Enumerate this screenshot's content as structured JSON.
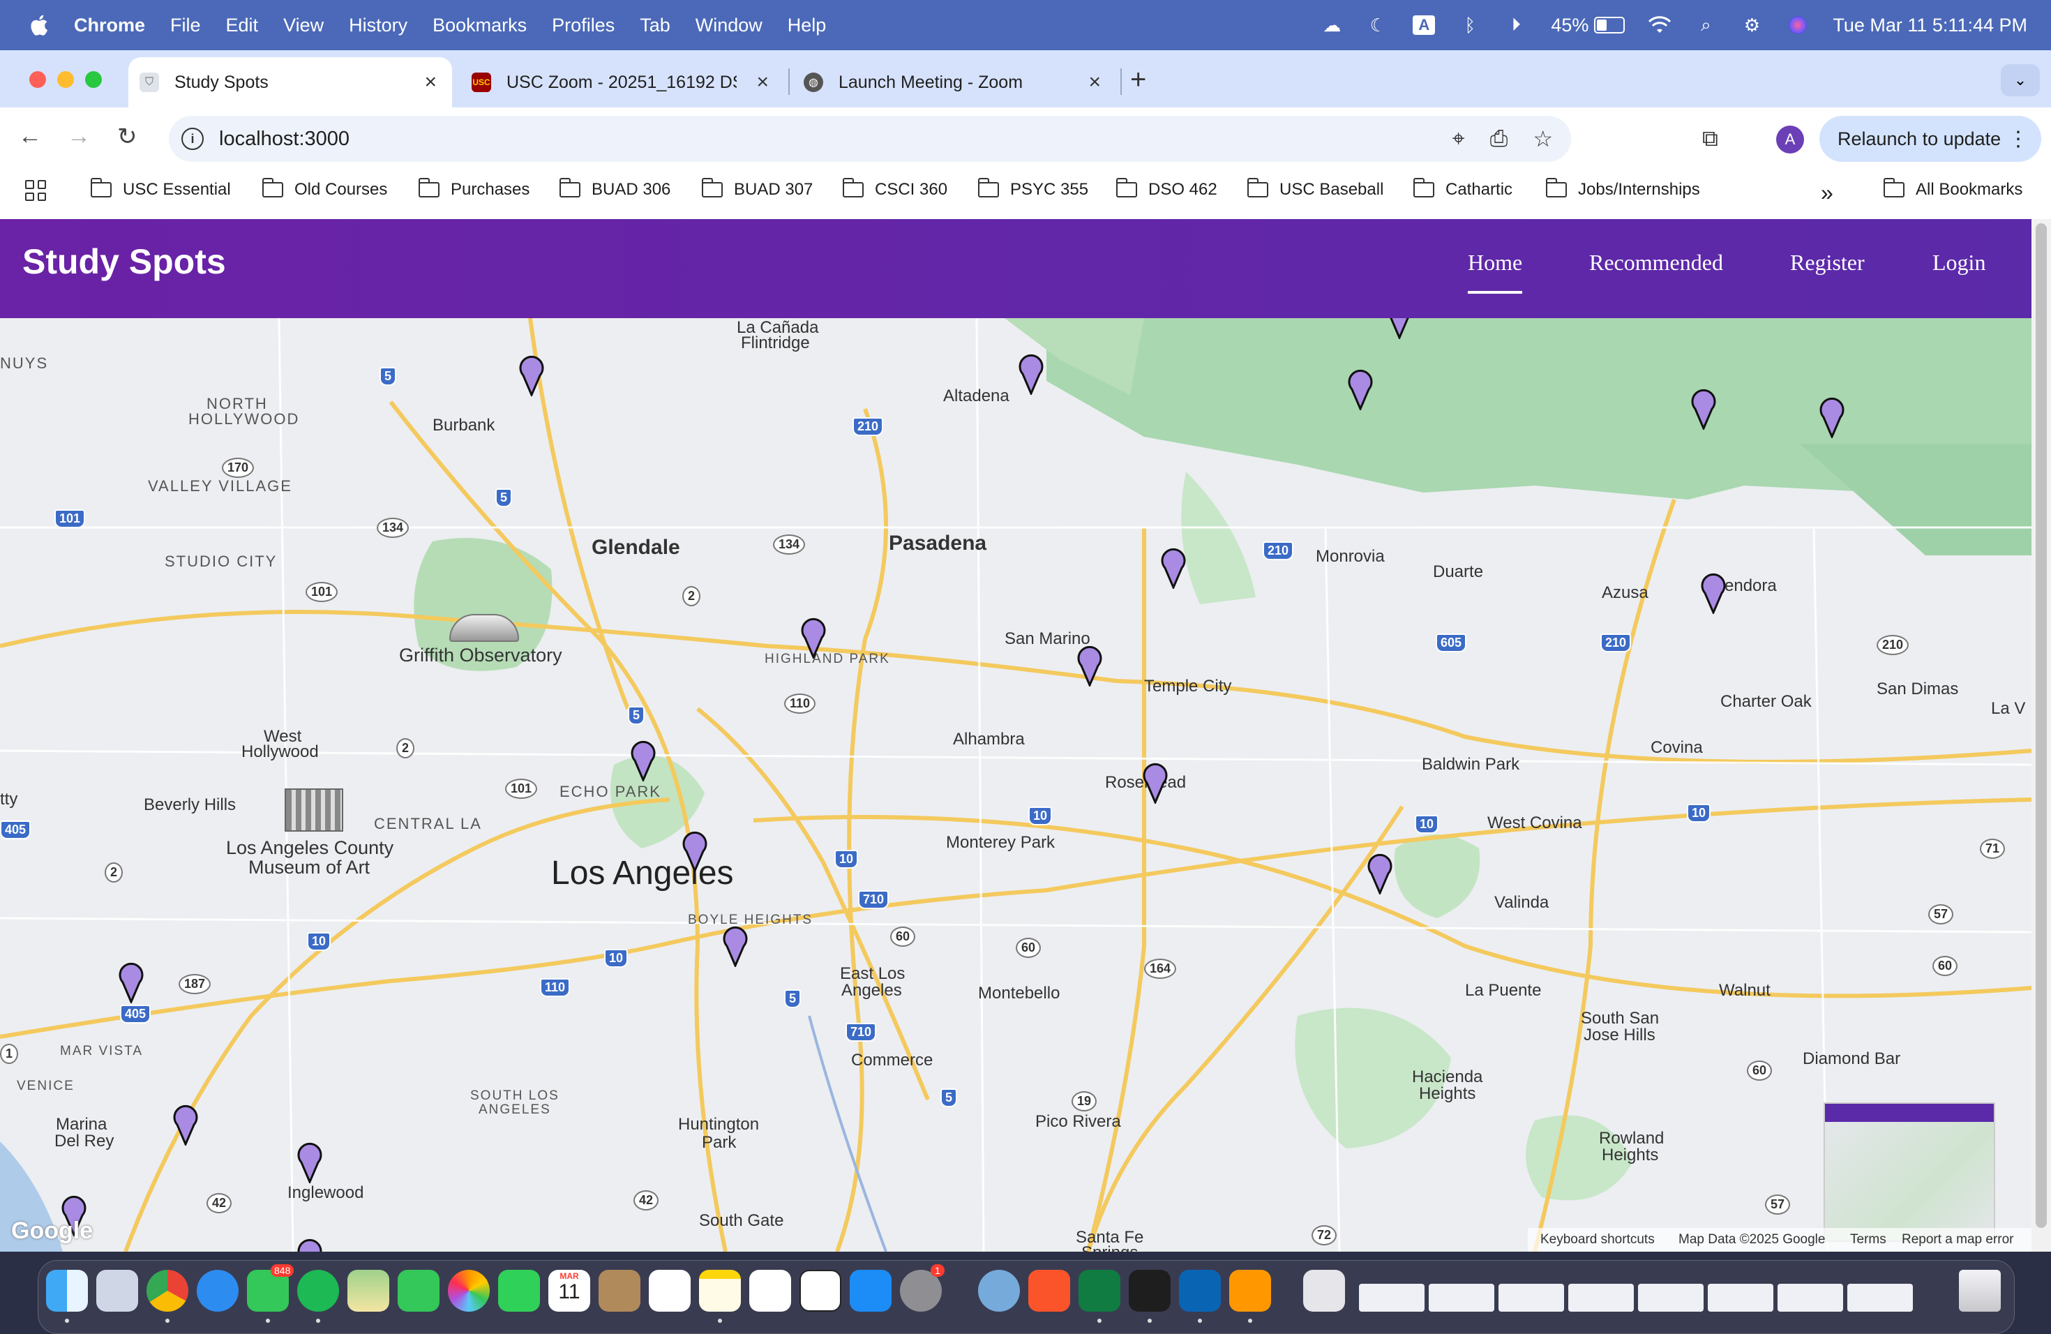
{
  "menubar": {
    "app": "Chrome",
    "items": [
      "File",
      "Edit",
      "View",
      "History",
      "Bookmarks",
      "Profiles",
      "Tab",
      "Window",
      "Help"
    ],
    "battery_percent": "45%",
    "battery_level": 0.45,
    "datetime": "Tue Mar 11  5:11:44 PM"
  },
  "tabs": [
    {
      "title": "Study Spots",
      "active": true
    },
    {
      "title": "USC Zoom - 20251_16192 DS",
      "active": false
    },
    {
      "title": "Launch Meeting - Zoom",
      "active": false
    }
  ],
  "toolbar": {
    "url": "localhost:3000",
    "relaunch_label": "Relaunch to update",
    "avatar_letter": "A"
  },
  "bookmarks": {
    "items": [
      "USC Essential",
      "Old Courses",
      "Purchases",
      "BUAD 306",
      "BUAD 307",
      "CSCI 360",
      "PSYC 355",
      "DSO 462",
      "USC Baseball",
      "Cathartic",
      "Jobs/Internships"
    ],
    "overflow": "»",
    "all": "All Bookmarks"
  },
  "site": {
    "brand": "Study Spots",
    "nav": [
      "Home",
      "Recommended",
      "Register",
      "Login"
    ]
  },
  "map": {
    "labels": {
      "los_angeles": "Los Angeles",
      "glendale": "Glendale",
      "pasadena": "Pasadena",
      "burbank": "Burbank",
      "altadena": "Altadena",
      "la_canada": "La Cañada",
      "flintridge": "Flintridge",
      "north_hollywood_1": "NORTH",
      "north_hollywood_2": "HOLLYWOOD",
      "valley_village": "VALLEY VILLAGE",
      "studio_city": "STUDIO CITY",
      "griffith": "Griffith Observatory",
      "west_hollywood_1": "West",
      "west_hollywood_2": "Hollywood",
      "beverly_hills": "Beverly Hills",
      "central_la": "CENTRAL LA",
      "lacma_1": "Los Angeles County",
      "lacma_2": "Museum of Art",
      "echo_park": "ECHO PARK",
      "highland_park": "HIGHLAND PARK",
      "boyle_heights": "BOYLE HEIGHTS",
      "monrovia": "Monrovia",
      "duarte": "Duarte",
      "azusa": "Azusa",
      "glendora": "Glendora",
      "san_marino": "San Marino",
      "temple_city": "Temple City",
      "alhambra": "Alhambra",
      "rosemead": "Rosemead",
      "monterey_park": "Monterey Park",
      "baldwin_park": "Baldwin Park",
      "west_covina": "West Covina",
      "covina": "Covina",
      "charter_oak": "Charter Oak",
      "san_dimas": "San Dimas",
      "la_verne": "La V",
      "valinda": "Valinda",
      "la_puente": "La Puente",
      "walnut": "Walnut",
      "south_san_jose_1": "South San",
      "south_san_jose_2": "Jose Hills",
      "diamond_bar": "Diamond Bar",
      "east_la_1": "East Los",
      "east_la_2": "Angeles",
      "montebello": "Montebello",
      "commerce": "Commerce",
      "pico_rivera": "Pico Rivera",
      "huntington_park_1": "Huntington",
      "huntington_park_2": "Park",
      "south_la_1": "SOUTH LOS",
      "south_la_2": "ANGELES",
      "hacienda_1": "Hacienda",
      "hacienda_2": "Heights",
      "rowland_1": "Rowland",
      "rowland_2": "Heights",
      "mar_vista": "MAR VISTA",
      "venice": "VENICE",
      "marina_1": "Marina",
      "marina_2": "Del Rey",
      "inglewood": "Inglewood",
      "south_gate": "South Gate",
      "santa_fe_1": "Santa Fe",
      "santa_fe_2": "Springs",
      "nuys": "NUYS",
      "tty": "tty"
    },
    "footer": {
      "keyboard": "Keyboard shortcuts",
      "data": "Map Data ©2025 Google",
      "terms": "Terms",
      "report": "Report a map error"
    },
    "google_logo": "Google",
    "pin_color": "#a98be3"
  },
  "dock": {
    "messages_badge": "848",
    "calendar_month": "MAR",
    "calendar_day": "11",
    "activity_badge": "1"
  }
}
